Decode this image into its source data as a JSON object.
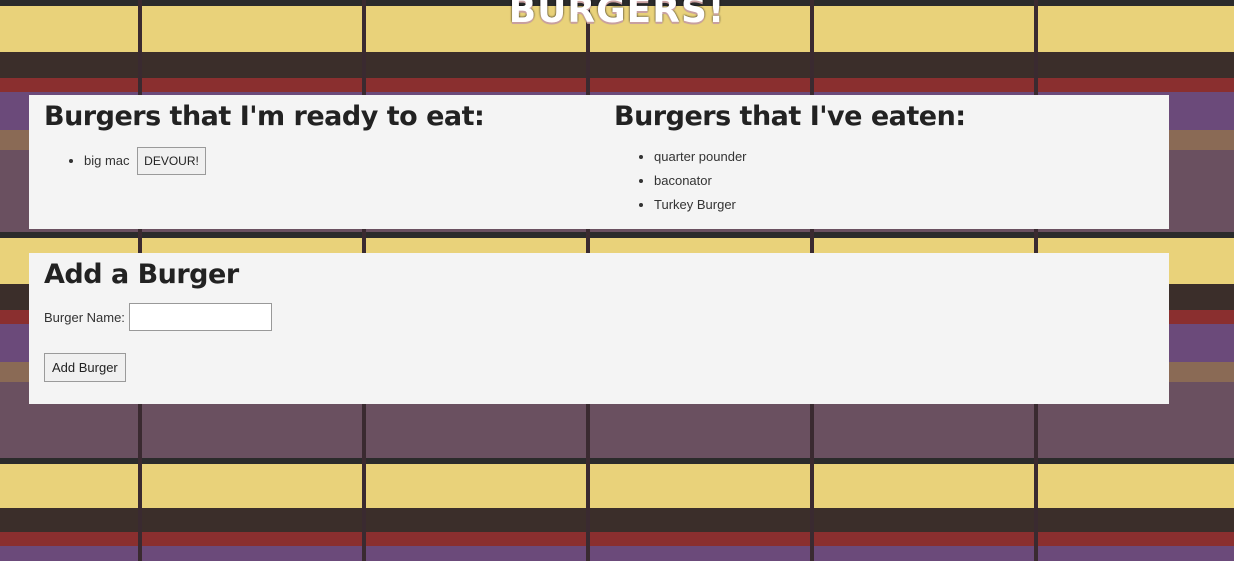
{
  "site": {
    "title": "BURGERS!"
  },
  "ready": {
    "heading": "Burgers that I'm ready to eat:",
    "items": [
      {
        "name": "big mac",
        "button": "DEVOUR!"
      }
    ]
  },
  "eaten": {
    "heading": "Burgers that I've eaten:",
    "items": [
      {
        "name": "quarter pounder"
      },
      {
        "name": "baconator"
      },
      {
        "name": "Turkey Burger"
      }
    ]
  },
  "add_form": {
    "heading": "Add a Burger",
    "label": "Burger Name:",
    "input_value": "",
    "submit_label": "Add Burger"
  }
}
